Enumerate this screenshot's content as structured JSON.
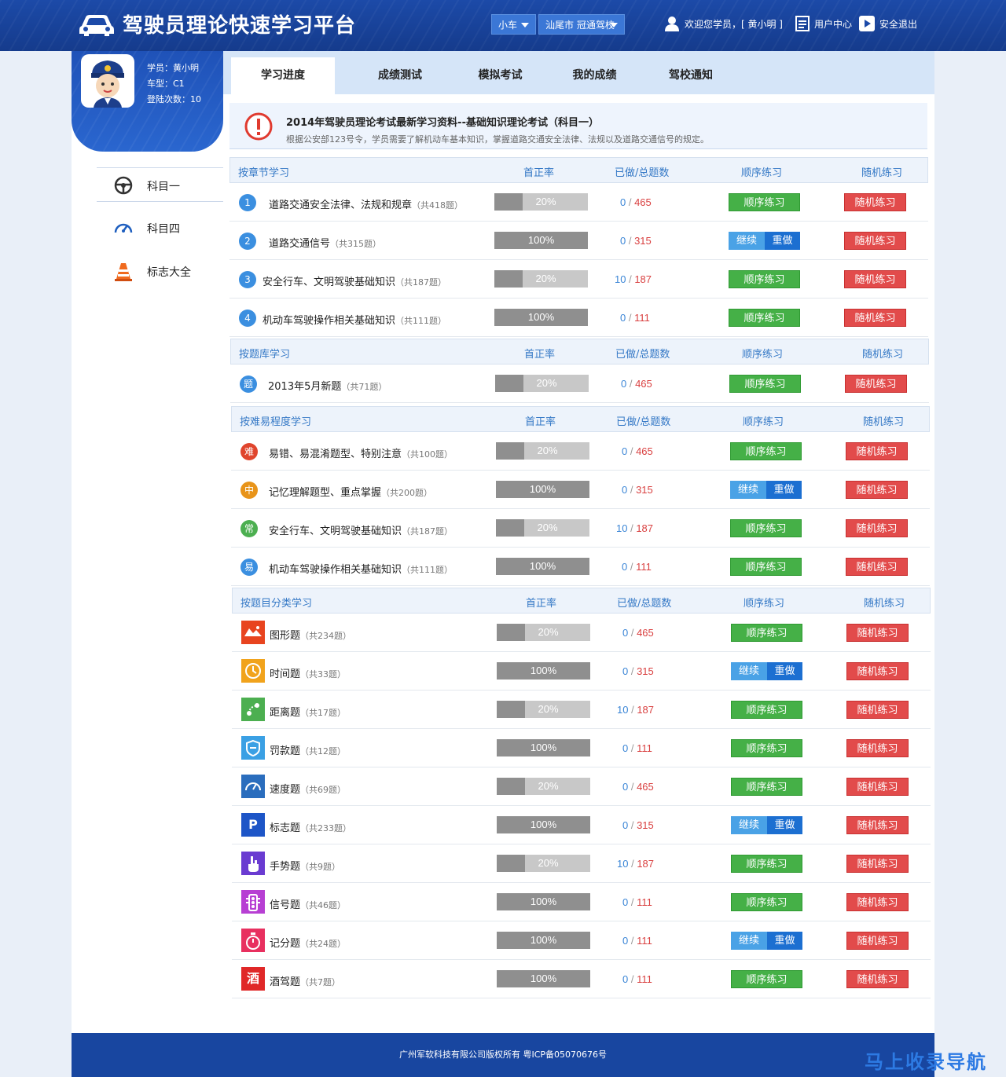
{
  "app": {
    "title": "驾驶员理论快速学习平台",
    "car_select": "小车",
    "school_select": "汕尾市  冠通驾校",
    "welcome": "欢迎您学员，[ 黄小明 ]",
    "user_center": "用户中心",
    "logout": "安全退出"
  },
  "profile": {
    "student": "学员：黄小明",
    "car_type": "车型：C1",
    "login_count": "登陆次数：10"
  },
  "sidebar": {
    "items": [
      {
        "label": "科目一",
        "icon": "steering-wheel-icon"
      },
      {
        "label": "科目四",
        "icon": "speedometer-icon"
      },
      {
        "label": "标志大全",
        "icon": "traffic-cone-icon"
      }
    ]
  },
  "tabs": [
    "学习进度",
    "成绩测试",
    "模拟考试",
    "我的成绩",
    "驾校通知"
  ],
  "notice": {
    "title": "2014年驾驶员理论考试最新学习资料--基础知识理论考试（科目一）",
    "desc": "根据公安部123号令，学员需要了解机动车基本知识，掌握道路交通安全法律、法规以及道路交通信号的规定。"
  },
  "columns": {
    "rate": "首正率",
    "count": "已做/总题数",
    "seq": "顺序练习",
    "rand": "随机练习"
  },
  "buttons": {
    "seq": "顺序练习",
    "rand": "随机练习",
    "cont": "继续",
    "redo": "重做"
  },
  "colors": {
    "header_blue": "#1c4aa8",
    "green_button": "#45b047",
    "red_button": "#e24b4b",
    "continue_blue": "#4aa2e6",
    "redo_blue": "#1c6fd1"
  },
  "sections": [
    {
      "title": "按章节学习",
      "rows": [
        {
          "icon_text": "1",
          "name": "道路交通安全法律、法规和规章",
          "total_note": "（共418题）",
          "rate": 0.2,
          "rate_label": "20%",
          "done": "0",
          "total": "465",
          "seq_mode": "seq"
        },
        {
          "icon_text": "2",
          "name": "道路交通信号",
          "total_note": "（共315题）",
          "rate": 1.0,
          "rate_label": "100%",
          "done": "0",
          "total": "315",
          "seq_mode": "pair"
        },
        {
          "icon_text": "3",
          "name": "安全行车、文明驾驶基础知识",
          "total_note": "（共187题）",
          "rate": 0.2,
          "rate_label": "20%",
          "done": "10",
          "total": "187",
          "seq_mode": "seq"
        },
        {
          "icon_text": "4",
          "name": "机动车驾驶操作相关基础知识",
          "total_note": "（共111题）",
          "rate": 1.0,
          "rate_label": "100%",
          "done": "0",
          "total": "111",
          "seq_mode": "seq"
        }
      ]
    },
    {
      "title": "按题库学习",
      "rows": [
        {
          "icon_text": "题",
          "name": "2013年5月新题",
          "total_note": "（共71题）",
          "rate": 0.2,
          "rate_label": "20%",
          "done": "0",
          "total": "465",
          "seq_mode": "seq"
        }
      ]
    },
    {
      "title": "按难易程度学习",
      "rows": [
        {
          "icon_text": "难",
          "name": "易错、易混淆题型、特别注意",
          "total_note": "（共100题）",
          "rate": 0.2,
          "rate_label": "20%",
          "done": "0",
          "total": "465",
          "seq_mode": "seq"
        },
        {
          "icon_text": "中",
          "name": "记忆理解题型、重点掌握",
          "total_note": "（共200题）",
          "rate": 1.0,
          "rate_label": "100%",
          "done": "0",
          "total": "315",
          "seq_mode": "pair"
        },
        {
          "icon_text": "常",
          "name": "安全行车、文明驾驶基础知识",
          "total_note": "（共187题）",
          "rate": 0.2,
          "rate_label": "20%",
          "done": "10",
          "total": "187",
          "seq_mode": "seq"
        },
        {
          "icon_text": "易",
          "name": "机动车驾驶操作相关基础知识",
          "total_note": "（共111题）",
          "rate": 1.0,
          "rate_label": "100%",
          "done": "0",
          "total": "111",
          "seq_mode": "seq"
        }
      ]
    },
    {
      "title": "按题目分类学习",
      "rows": [
        {
          "icon_text": "",
          "name": "图形题",
          "total_note": "（共234题）",
          "rate": 0.2,
          "rate_label": "20%",
          "done": "0",
          "total": "465",
          "seq_mode": "seq"
        },
        {
          "icon_text": "",
          "name": "时间题",
          "total_note": "（共33题）",
          "rate": 1.0,
          "rate_label": "100%",
          "done": "0",
          "total": "315",
          "seq_mode": "pair"
        },
        {
          "icon_text": "",
          "name": "距离题",
          "total_note": "（共17题）",
          "rate": 0.2,
          "rate_label": "20%",
          "done": "10",
          "total": "187",
          "seq_mode": "seq"
        },
        {
          "icon_text": "",
          "name": "罚款题",
          "total_note": "（共12题）",
          "rate": 1.0,
          "rate_label": "100%",
          "done": "0",
          "total": "111",
          "seq_mode": "seq"
        },
        {
          "icon_text": "",
          "name": "速度题",
          "total_note": "（共69题）",
          "rate": 0.2,
          "rate_label": "20%",
          "done": "0",
          "total": "465",
          "seq_mode": "seq"
        },
        {
          "icon_text": "P",
          "name": "标志题",
          "total_note": "（共233题）",
          "rate": 1.0,
          "rate_label": "100%",
          "done": "0",
          "total": "315",
          "seq_mode": "pair"
        },
        {
          "icon_text": "",
          "name": "手势题",
          "total_note": "（共9题）",
          "rate": 0.2,
          "rate_label": "20%",
          "done": "10",
          "total": "187",
          "seq_mode": "seq"
        },
        {
          "icon_text": "",
          "name": "信号题",
          "total_note": "（共46题）",
          "rate": 1.0,
          "rate_label": "100%",
          "done": "0",
          "total": "111",
          "seq_mode": "seq"
        },
        {
          "icon_text": "",
          "name": "记分题",
          "total_note": "（共24题）",
          "rate": 1.0,
          "rate_label": "100%",
          "done": "0",
          "total": "111",
          "seq_mode": "pair"
        },
        {
          "icon_text": "酒",
          "name": "酒驾题",
          "total_note": "（共7题）",
          "rate": 1.0,
          "rate_label": "100%",
          "done": "0",
          "total": "111",
          "seq_mode": "seq"
        }
      ]
    }
  ],
  "footer": "广州军软科技有限公司版权所有  粤ICP备05070676号",
  "watermark": "马上收录导航"
}
